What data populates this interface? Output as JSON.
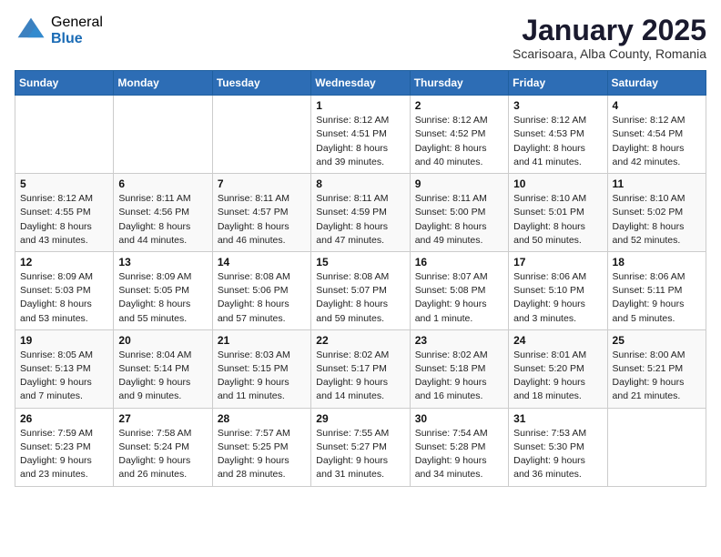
{
  "logo": {
    "general": "General",
    "blue": "Blue"
  },
  "title": "January 2025",
  "subtitle": "Scarisoara, Alba County, Romania",
  "weekdays": [
    "Sunday",
    "Monday",
    "Tuesday",
    "Wednesday",
    "Thursday",
    "Friday",
    "Saturday"
  ],
  "weeks": [
    [
      {
        "day": "",
        "info": ""
      },
      {
        "day": "",
        "info": ""
      },
      {
        "day": "",
        "info": ""
      },
      {
        "day": "1",
        "info": "Sunrise: 8:12 AM\nSunset: 4:51 PM\nDaylight: 8 hours\nand 39 minutes."
      },
      {
        "day": "2",
        "info": "Sunrise: 8:12 AM\nSunset: 4:52 PM\nDaylight: 8 hours\nand 40 minutes."
      },
      {
        "day": "3",
        "info": "Sunrise: 8:12 AM\nSunset: 4:53 PM\nDaylight: 8 hours\nand 41 minutes."
      },
      {
        "day": "4",
        "info": "Sunrise: 8:12 AM\nSunset: 4:54 PM\nDaylight: 8 hours\nand 42 minutes."
      }
    ],
    [
      {
        "day": "5",
        "info": "Sunrise: 8:12 AM\nSunset: 4:55 PM\nDaylight: 8 hours\nand 43 minutes."
      },
      {
        "day": "6",
        "info": "Sunrise: 8:11 AM\nSunset: 4:56 PM\nDaylight: 8 hours\nand 44 minutes."
      },
      {
        "day": "7",
        "info": "Sunrise: 8:11 AM\nSunset: 4:57 PM\nDaylight: 8 hours\nand 46 minutes."
      },
      {
        "day": "8",
        "info": "Sunrise: 8:11 AM\nSunset: 4:59 PM\nDaylight: 8 hours\nand 47 minutes."
      },
      {
        "day": "9",
        "info": "Sunrise: 8:11 AM\nSunset: 5:00 PM\nDaylight: 8 hours\nand 49 minutes."
      },
      {
        "day": "10",
        "info": "Sunrise: 8:10 AM\nSunset: 5:01 PM\nDaylight: 8 hours\nand 50 minutes."
      },
      {
        "day": "11",
        "info": "Sunrise: 8:10 AM\nSunset: 5:02 PM\nDaylight: 8 hours\nand 52 minutes."
      }
    ],
    [
      {
        "day": "12",
        "info": "Sunrise: 8:09 AM\nSunset: 5:03 PM\nDaylight: 8 hours\nand 53 minutes."
      },
      {
        "day": "13",
        "info": "Sunrise: 8:09 AM\nSunset: 5:05 PM\nDaylight: 8 hours\nand 55 minutes."
      },
      {
        "day": "14",
        "info": "Sunrise: 8:08 AM\nSunset: 5:06 PM\nDaylight: 8 hours\nand 57 minutes."
      },
      {
        "day": "15",
        "info": "Sunrise: 8:08 AM\nSunset: 5:07 PM\nDaylight: 8 hours\nand 59 minutes."
      },
      {
        "day": "16",
        "info": "Sunrise: 8:07 AM\nSunset: 5:08 PM\nDaylight: 9 hours\nand 1 minute."
      },
      {
        "day": "17",
        "info": "Sunrise: 8:06 AM\nSunset: 5:10 PM\nDaylight: 9 hours\nand 3 minutes."
      },
      {
        "day": "18",
        "info": "Sunrise: 8:06 AM\nSunset: 5:11 PM\nDaylight: 9 hours\nand 5 minutes."
      }
    ],
    [
      {
        "day": "19",
        "info": "Sunrise: 8:05 AM\nSunset: 5:13 PM\nDaylight: 9 hours\nand 7 minutes."
      },
      {
        "day": "20",
        "info": "Sunrise: 8:04 AM\nSunset: 5:14 PM\nDaylight: 9 hours\nand 9 minutes."
      },
      {
        "day": "21",
        "info": "Sunrise: 8:03 AM\nSunset: 5:15 PM\nDaylight: 9 hours\nand 11 minutes."
      },
      {
        "day": "22",
        "info": "Sunrise: 8:02 AM\nSunset: 5:17 PM\nDaylight: 9 hours\nand 14 minutes."
      },
      {
        "day": "23",
        "info": "Sunrise: 8:02 AM\nSunset: 5:18 PM\nDaylight: 9 hours\nand 16 minutes."
      },
      {
        "day": "24",
        "info": "Sunrise: 8:01 AM\nSunset: 5:20 PM\nDaylight: 9 hours\nand 18 minutes."
      },
      {
        "day": "25",
        "info": "Sunrise: 8:00 AM\nSunset: 5:21 PM\nDaylight: 9 hours\nand 21 minutes."
      }
    ],
    [
      {
        "day": "26",
        "info": "Sunrise: 7:59 AM\nSunset: 5:23 PM\nDaylight: 9 hours\nand 23 minutes."
      },
      {
        "day": "27",
        "info": "Sunrise: 7:58 AM\nSunset: 5:24 PM\nDaylight: 9 hours\nand 26 minutes."
      },
      {
        "day": "28",
        "info": "Sunrise: 7:57 AM\nSunset: 5:25 PM\nDaylight: 9 hours\nand 28 minutes."
      },
      {
        "day": "29",
        "info": "Sunrise: 7:55 AM\nSunset: 5:27 PM\nDaylight: 9 hours\nand 31 minutes."
      },
      {
        "day": "30",
        "info": "Sunrise: 7:54 AM\nSunset: 5:28 PM\nDaylight: 9 hours\nand 34 minutes."
      },
      {
        "day": "31",
        "info": "Sunrise: 7:53 AM\nSunset: 5:30 PM\nDaylight: 9 hours\nand 36 minutes."
      },
      {
        "day": "",
        "info": ""
      }
    ]
  ]
}
